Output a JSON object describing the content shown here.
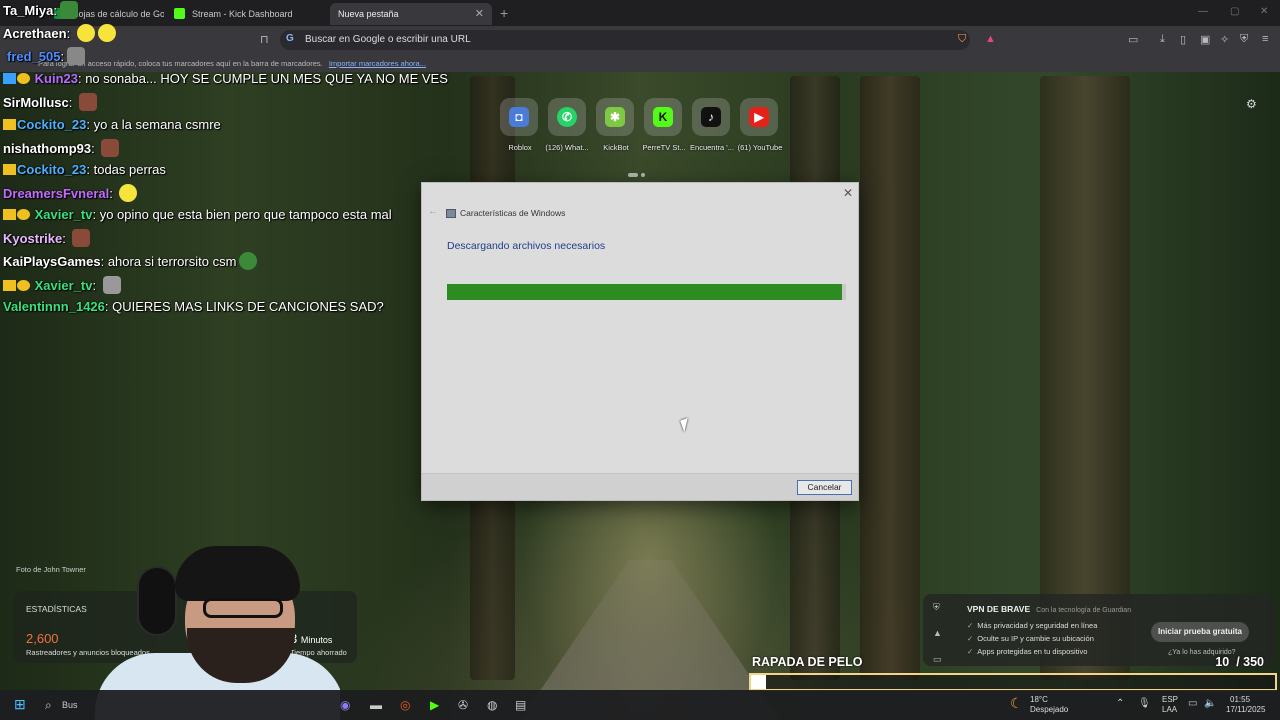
{
  "browser": {
    "tabs": [
      {
        "label": "Hojas de cálculo de Google",
        "active": false
      },
      {
        "label": "Stream - Kick Dashboard",
        "active": false
      },
      {
        "label": "Nueva pestaña",
        "active": true
      }
    ],
    "omnibox_placeholder": "Buscar en Google o escribir una URL",
    "bookmarks_hint": "Para lograr un acceso rápido, coloca tus marcadores aquí en la barra de marcadores.",
    "bookmarks_link": "Importar marcadores ahora..."
  },
  "chat": [
    {
      "user": "Ta_Miya",
      "text": "",
      "color": "#ffffff"
    },
    {
      "user": "Acrethaen",
      "text": "",
      "color": "#ffffff"
    },
    {
      "user": "fred_505",
      "text": "",
      "color": "#4c8dff"
    },
    {
      "user": "Kuin23",
      "text": "no sonaba... HOY SE CUMPLE UN MES QUE YA NO ME VES",
      "color": "#b86cff"
    },
    {
      "user": "SirMollusc",
      "text": "",
      "color": "#ffffff"
    },
    {
      "user": "Cockito_23",
      "text": "yo a la semana csmre",
      "color": "#4cb0ff"
    },
    {
      "user": "nishathomp93",
      "text": "",
      "color": "#ffffff"
    },
    {
      "user": "Cockito_23",
      "text": "todas perras",
      "color": "#4cb0ff"
    },
    {
      "user": "DreamersFvneral",
      "text": "",
      "color": "#c36bff"
    },
    {
      "user": "Xavier_tv",
      "text": "yo opino que esta bien pero que tampoco esta mal",
      "color": "#3be07d"
    },
    {
      "user": "Kyostrike",
      "text": "",
      "color": "#ffffff"
    },
    {
      "user": "KaiPlaysGames",
      "text": "ahora si terrorsito csm",
      "color": "#ffffff"
    },
    {
      "user": "Xavier_tv",
      "text": "",
      "color": "#3be07d"
    },
    {
      "user": "Valentinnn_1426",
      "text": "QUIERES MAS LINKS DE CANCIONES SAD?",
      "color": "#3be07d"
    }
  ],
  "speed_dial": [
    {
      "label": "Roblox",
      "icon": "roblox-icon",
      "bg": "#4a7bd8",
      "glyph": "◘"
    },
    {
      "label": "(126) What...",
      "icon": "whatsapp-icon",
      "bg": "#25d366",
      "glyph": "✆"
    },
    {
      "label": "KickBot",
      "icon": "kickbot-icon",
      "bg": "#7ec843",
      "glyph": "✱"
    },
    {
      "label": "PerreTV St...",
      "icon": "kick-icon",
      "bg": "#53fc18",
      "glyph": "K"
    },
    {
      "label": "Encuentra '...",
      "icon": "tiktok-icon",
      "bg": "#111111",
      "glyph": "♪"
    },
    {
      "label": "(61) YouTube",
      "icon": "youtube-icon",
      "bg": "#e62117",
      "glyph": "▶"
    }
  ],
  "dialog": {
    "title": "Características de Windows",
    "heading": "Descargando archivos necesarios",
    "progress_fraction": 0.99,
    "cancel_label": "Cancelar"
  },
  "background": {
    "photo_credit": "Foto de John Towner"
  },
  "stats": {
    "title": "ESTADÍSTICAS",
    "blocked_value": "2,600",
    "blocked_label": "Rastreadores y anuncios bloqueados",
    "saved_partial_label": "ahorrado",
    "time_value": "3",
    "time_unit": "Minutos",
    "time_label": "Tiempo ahorrado"
  },
  "vpn": {
    "title": "VPN DE BRAVE",
    "subtitle": "Con la tecnología de Guardian",
    "features": [
      "Más privacidad y seguridad en línea",
      "Oculte su IP y cambie su ubicación",
      "Apps protegidas en tu dispositivo"
    ],
    "cta": "Iniciar prueba gratuita",
    "already": "¿Ya lo has adquirido?"
  },
  "goal": {
    "title": "RAPADA DE PELO",
    "current": "10",
    "total": "/ 350",
    "fraction": 0.028
  },
  "taskbar": {
    "search_partial": "Bus",
    "weather_temp": "18°C",
    "weather_desc": "Despejado",
    "lang1": "ESP",
    "lang2": "LAA",
    "time": "01:55",
    "date": "17/11/2025"
  }
}
